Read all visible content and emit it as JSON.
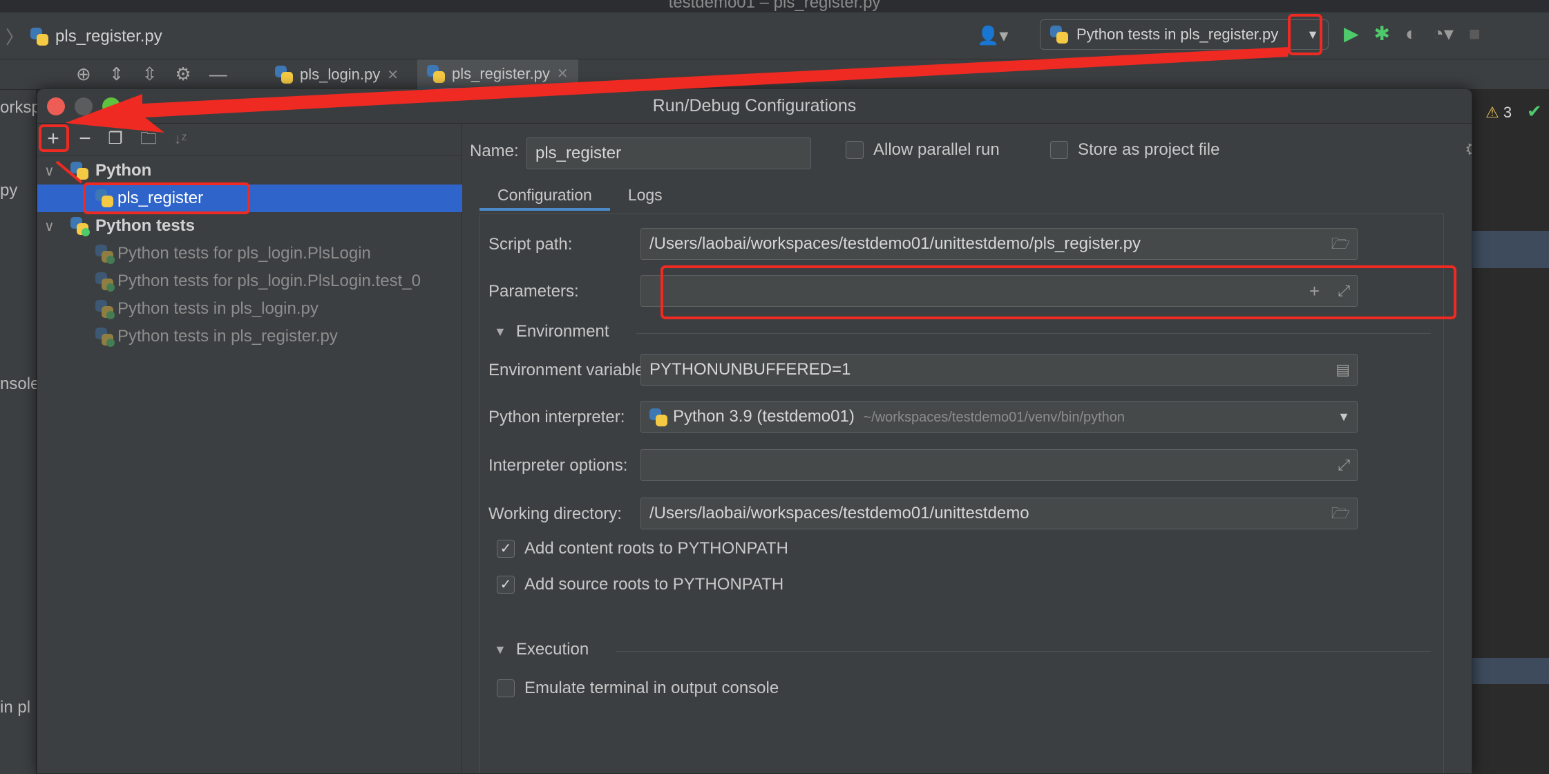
{
  "window_title": "testdemo01 – pls_register.py",
  "breadcrumb": {
    "file": "pls_register.py"
  },
  "run_config_combo": "Python tests in pls_register.py",
  "editor_tabs": [
    {
      "label": "pls_login.py",
      "active": false
    },
    {
      "label": "pls_register.py",
      "active": true
    }
  ],
  "bg_fragments": {
    "workspace": "orksp",
    "py": "py",
    "console": "nsole",
    "in_pl": "in pl"
  },
  "inspection": {
    "warnings": "3"
  },
  "dialog": {
    "title": "Run/Debug Configurations",
    "tree": [
      {
        "label": "Python",
        "group": true
      },
      {
        "label": "pls_register",
        "selected": true
      },
      {
        "label": "Python tests",
        "group": true
      },
      {
        "label": "Python tests for pls_login.PlsLogin"
      },
      {
        "label": "Python tests for pls_login.PlsLogin.test_0"
      },
      {
        "label": "Python tests in pls_login.py"
      },
      {
        "label": "Python tests in pls_register.py"
      }
    ],
    "name_label": "Name:",
    "name_value": "pls_register",
    "allow_parallel": "Allow parallel run",
    "store_project": "Store as project file",
    "tabs": [
      "Configuration",
      "Logs"
    ],
    "script_path_label": "Script path:",
    "script_path_value": "/Users/laobai/workspaces/testdemo01/unittestdemo/pls_register.py",
    "parameters_label": "Parameters:",
    "environment_section": "Environment",
    "env_vars_label": "Environment variables:",
    "env_vars_value": "PYTHONUNBUFFERED=1",
    "interpreter_label": "Python interpreter:",
    "interpreter_name": "Python 3.9 (testdemo01)",
    "interpreter_path": "~/workspaces/testdemo01/venv/bin/python",
    "interp_options_label": "Interpreter options:",
    "working_dir_label": "Working directory:",
    "working_dir_value": "/Users/laobai/workspaces/testdemo01/unittestdemo",
    "add_content_roots": "Add content roots to PYTHONPATH",
    "add_source_roots": "Add source roots to PYTHONPATH",
    "execution_section": "Execution",
    "emulate_terminal": "Emulate terminal in output console"
  },
  "colors": {
    "annotation": "#ee2a22",
    "selection": "#2f65ca",
    "accent": "#4a88c7"
  }
}
